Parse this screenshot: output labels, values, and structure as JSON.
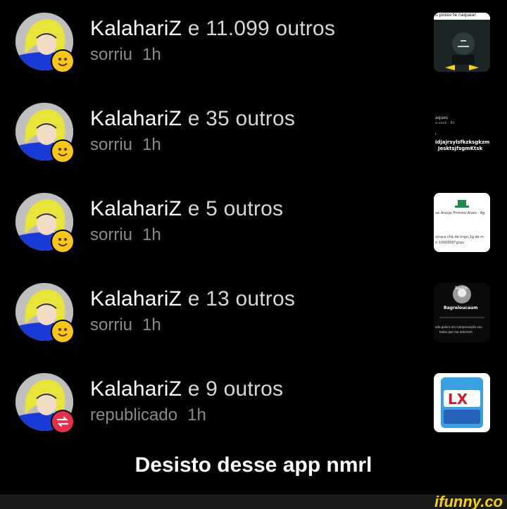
{
  "notifications": [
    {
      "user": "KalahariZ",
      "others": "e 11.099 outros",
      "action": "sorriu",
      "time": "1h",
      "badge": "smile",
      "thumb_texts": [
        "u posso te naquear"
      ]
    },
    {
      "user": "KalahariZ",
      "others": "e 35 outros",
      "action": "sorriu",
      "time": "1h",
      "badge": "smile",
      "thumb_texts": [
        "aques",
        "a você · 8h",
        "i.",
        "idjajrsylsfkzksgkzm",
        "JesktsjfsgmKtsk"
      ]
    },
    {
      "user": "KalahariZ",
      "others": "e 5 outros",
      "action": "sorriu",
      "time": "1h",
      "badge": "smile",
      "thumb_texts": [
        "ue Araújo Firmino Alves · Ag",
        "xícara chá de trigo,1g de m",
        "n 1000000°grau"
      ]
    },
    {
      "user": "KalahariZ",
      "others": "e 13 outros",
      "action": "sorriu",
      "time": "1h",
      "badge": "smile",
      "thumb_texts": [
        "Bagre",
        "Bagreloucaum",
        "ado galera em compensação vou",
        "todos que me aderirem"
      ]
    },
    {
      "user": "KalahariZ",
      "others": "e 9 outros",
      "action": "republicado",
      "time": "1h",
      "badge": "repost",
      "thumb_texts": [
        "LX"
      ]
    }
  ],
  "caption": "Desisto desse app nmrl",
  "watermark": "ifunny.co",
  "colors": {
    "background": "#000000",
    "smile_badge": "#f7c61c",
    "repost_badge": "#e8304a",
    "secondary_text": "#8a8a8a",
    "watermark": "#f5d10b"
  }
}
